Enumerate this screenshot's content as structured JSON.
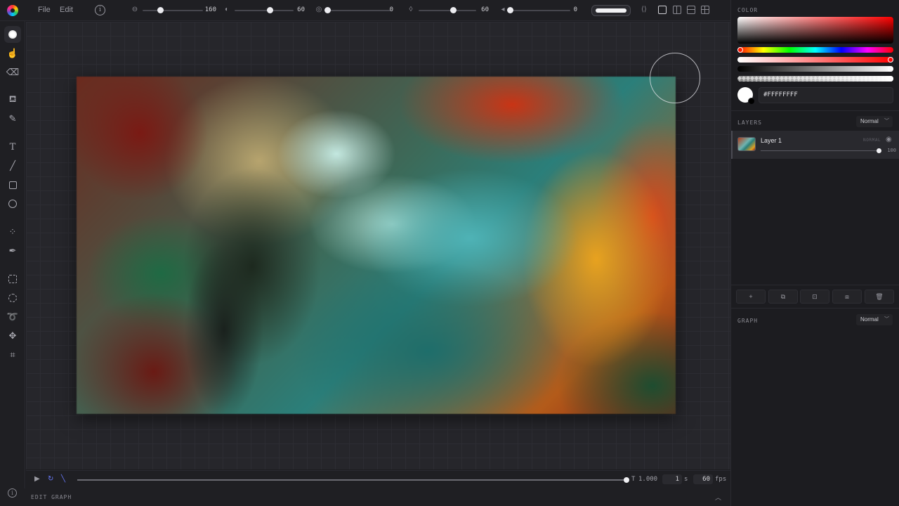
{
  "menu": {
    "file": "File",
    "edit": "Edit",
    "info": "i"
  },
  "sliders": [
    {
      "value": "160",
      "level": 0.29
    },
    {
      "value": "60",
      "level": 0.6
    },
    {
      "value": "0",
      "level": 0.0
    },
    {
      "value": "60",
      "level": 0.6
    },
    {
      "value": "0",
      "level": 0.0
    }
  ],
  "timeline": {
    "t_label": "T",
    "t_value": "1.000",
    "duration": "1",
    "duration_unit": "s",
    "fps": "60",
    "fps_unit": "fps",
    "progress": 1.0
  },
  "bottom": {
    "edit_graph": "EDIT GRAPH",
    "info": "i"
  },
  "color": {
    "title": "COLOR",
    "hex": "#FFFFFFFF",
    "primary": "#FFFFFF",
    "hue_fraction": 0.0,
    "saturation_fraction": 1.0,
    "lightness_fraction": 1.0,
    "alpha_fraction": 1.0
  },
  "layers": {
    "title": "LAYERS",
    "blend_mode": "Normal",
    "items": [
      {
        "name": "Layer 1",
        "mode": "NORMAL",
        "opacity": "100"
      }
    ]
  },
  "graph": {
    "title": "GRAPH",
    "blend_mode": "Normal"
  },
  "icons": {
    "tools": [
      "brush-icon",
      "smudge-icon",
      "eraser-icon",
      "fill-icon",
      "eyedropper-icon",
      "text-icon",
      "line-icon",
      "rectangle-icon",
      "ellipse-icon",
      "points-icon",
      "pen-icon",
      "rect-select-icon",
      "ellipse-select-icon",
      "lasso-icon",
      "move-icon",
      "crop-icon"
    ]
  }
}
